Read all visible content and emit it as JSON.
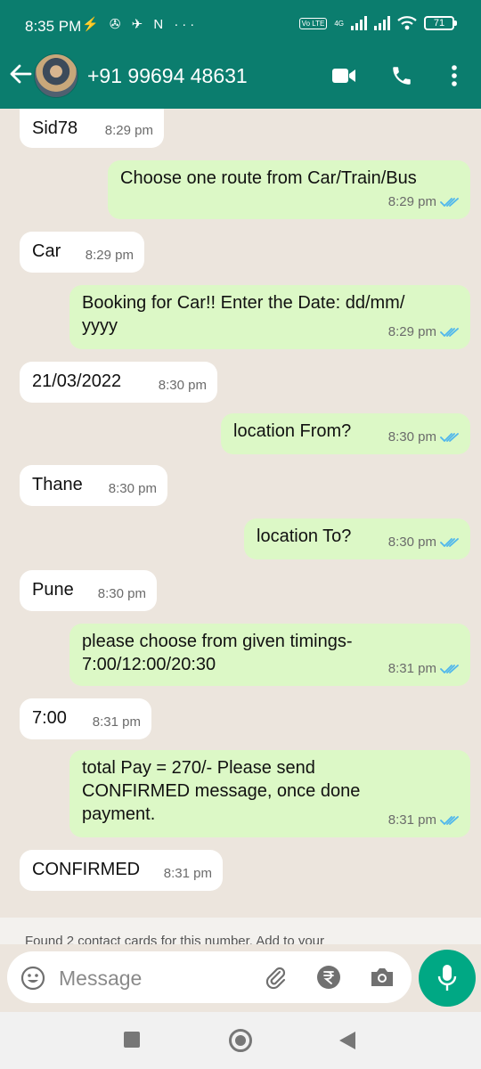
{
  "status_bar": {
    "time": "8:35 PM",
    "notif_icons": "⚡ ✇ ✈ N ···",
    "network": "4G",
    "volte": "Vo LTE",
    "battery": "71"
  },
  "header": {
    "contact": "+91 99694 48631"
  },
  "messages": [
    {
      "dir": "in",
      "lines": [
        "Sid78"
      ],
      "time": "8:29 pm"
    },
    {
      "dir": "out",
      "lines": [
        "Choose one route from Car/Train/Bus"
      ],
      "time": "8:29 pm"
    },
    {
      "dir": "in",
      "lines": [
        "Car"
      ],
      "time": "8:29 pm"
    },
    {
      "dir": "out",
      "lines": [
        "Booking for Car!! Enter the Date: dd/mm/",
        "yyyy"
      ],
      "time": "8:29 pm"
    },
    {
      "dir": "in",
      "lines": [
        "21/03/2022"
      ],
      "time": "8:30 pm"
    },
    {
      "dir": "out",
      "lines": [
        "location From?"
      ],
      "time": "8:30 pm"
    },
    {
      "dir": "in",
      "lines": [
        "Thane"
      ],
      "time": "8:30 pm"
    },
    {
      "dir": "out",
      "lines": [
        "location To?"
      ],
      "time": "8:30 pm"
    },
    {
      "dir": "in",
      "lines": [
        "Pune"
      ],
      "time": "8:30 pm"
    },
    {
      "dir": "out",
      "lines": [
        "please choose from given timings-",
        "7:00/12:00/20:30"
      ],
      "time": "8:31 pm"
    },
    {
      "dir": "in",
      "lines": [
        "7:00"
      ],
      "time": "8:31 pm"
    },
    {
      "dir": "out",
      "lines": [
        "total Pay = 270/-  Please send",
        "CONFIRMED message, once done",
        "payment."
      ],
      "time": "8:31 pm"
    },
    {
      "dir": "in",
      "lines": [
        "CONFIRMED"
      ],
      "time": "8:31 pm"
    }
  ],
  "notice": "Found 2 contact cards for this number. Add to your",
  "composer": {
    "placeholder": "Message"
  },
  "colors": {
    "header": "#0b7d6e",
    "outgoing": "#dcf8c6",
    "incoming": "#ffffff",
    "accent": "#00a884",
    "read_ticks": "#4fb6ec"
  }
}
